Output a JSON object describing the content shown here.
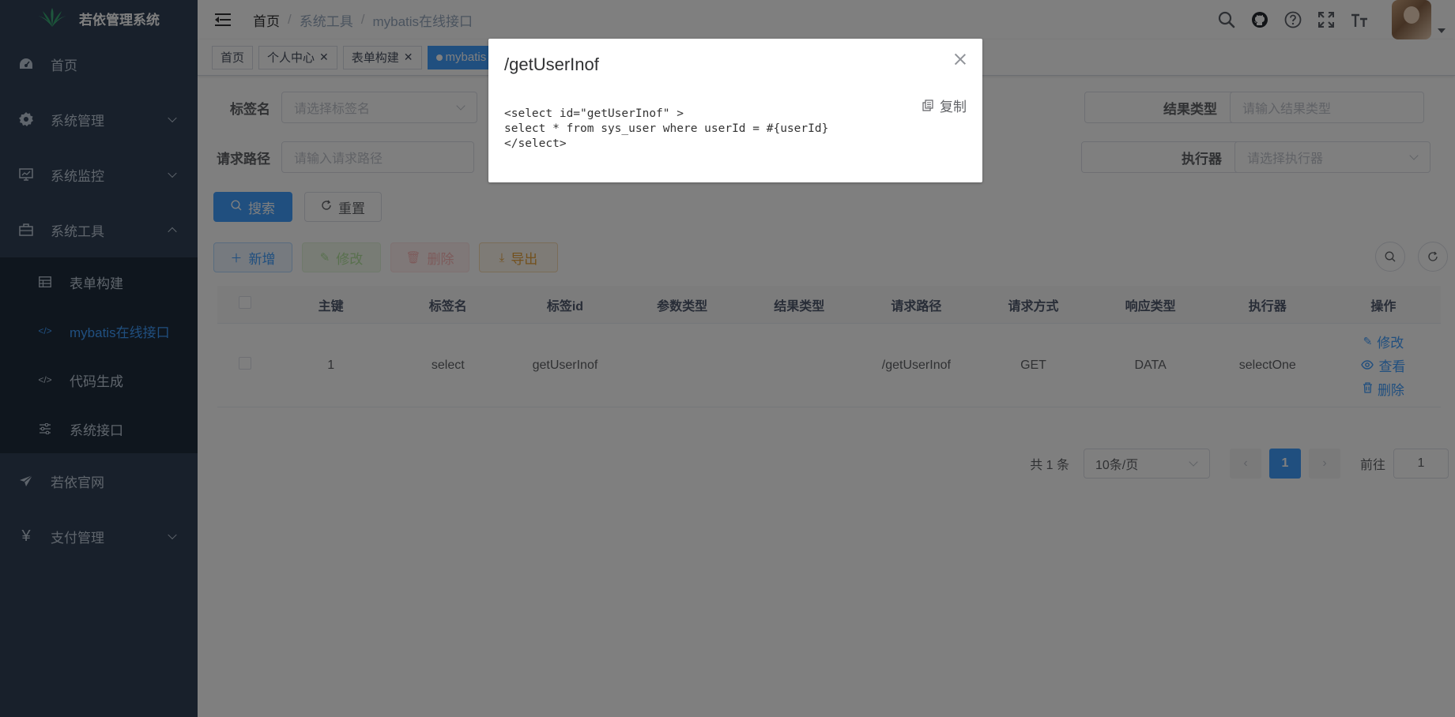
{
  "sidebar": {
    "title": "若依管理系统",
    "menu": [
      {
        "label": "首页",
        "icon": "dashboard-icon"
      },
      {
        "label": "系统管理",
        "icon": "gear-icon"
      },
      {
        "label": "系统监控",
        "icon": "monitor-icon"
      },
      {
        "label": "系统工具",
        "icon": "toolbox-icon",
        "expanded": true
      }
    ],
    "submenu": [
      {
        "label": "表单构建",
        "icon": "table-icon"
      },
      {
        "label": "mybatis在线接口",
        "icon": "code-icon",
        "active": true
      },
      {
        "label": "代码生成",
        "icon": "code-icon"
      },
      {
        "label": "系统接口",
        "icon": "sliders-icon"
      }
    ],
    "menu_after": [
      {
        "label": "若依官网",
        "icon": "paper-plane-icon"
      },
      {
        "label": "支付管理",
        "icon": "yen-icon"
      }
    ]
  },
  "navbar": {
    "breadcrumb": [
      "首页",
      "系统工具",
      "mybatis在线接口"
    ]
  },
  "tags": [
    {
      "label": "首页",
      "closable": false
    },
    {
      "label": "个人中心",
      "closable": true
    },
    {
      "label": "表单构建",
      "closable": true
    },
    {
      "label": "mybatis",
      "active": true
    }
  ],
  "search_form": {
    "tag_name_label": "标签名",
    "tag_name_placeholder": "请选择标签名",
    "result_type_label": "结果类型",
    "result_type_placeholder": "请输入结果类型",
    "request_path_label": "请求路径",
    "request_path_placeholder": "请输入请求路径",
    "executor_label": "执行器",
    "executor_placeholder": "请选择执行器",
    "search_button": "搜索",
    "reset_button": "重置"
  },
  "toolbar": {
    "add": "新增",
    "edit": "修改",
    "delete": "删除",
    "export": "导出"
  },
  "table": {
    "headers": [
      "主键",
      "标签名",
      "标签id",
      "参数类型",
      "结果类型",
      "请求路径",
      "请求方式",
      "响应类型",
      "执行器",
      "操作"
    ],
    "rows": [
      {
        "id": "1",
        "tag_name": "select",
        "tag_id": "getUserInof",
        "param_type": "",
        "result_type": "",
        "path": "/getUserInof",
        "method": "GET",
        "response_type": "DATA",
        "executor": "selectOne"
      }
    ],
    "ops": {
      "edit": "修改",
      "view": "查看",
      "delete": "删除"
    }
  },
  "pagination": {
    "total": "共 1 条",
    "page_size": "10条/页",
    "current": "1",
    "goto_label": "前往",
    "goto_value": "1"
  },
  "dialog": {
    "title": "/getUserInof",
    "copy_label": "复制",
    "code": "<select id=\"getUserInof\" >\nselect * from sys_user where userId = #{userId}\n</select>"
  },
  "colors": {
    "sidebar_bg": "#304156",
    "submenu_bg": "#1f2d3d",
    "primary": "#409eff"
  }
}
